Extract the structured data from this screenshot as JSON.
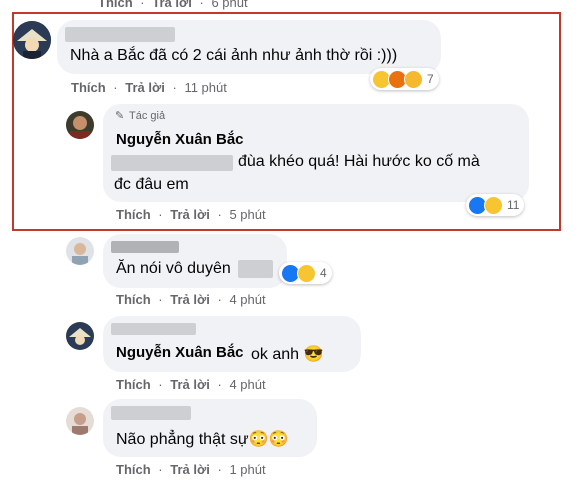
{
  "top_partial": {
    "like": "Thích",
    "reply": "Trả lời",
    "time": "6 phút"
  },
  "comments": [
    {
      "text": "Nhà a Bắc đã có 2 cái ảnh như ảnh thờ rồi :)))",
      "like": "Thích",
      "reply": "Trả lời",
      "time": "11 phút",
      "reaction_count": "7",
      "reactions": [
        "haha-icon",
        "angry-icon",
        "wow-icon"
      ]
    },
    {
      "author_badge": "Tác giả",
      "name": "Nguyễn Xuân Bắc",
      "text_line1": "đùa khéo quá! Hài hước ko cố mà",
      "text_line2": "đc đâu em",
      "like": "Thích",
      "reply": "Trả lời",
      "time": "5 phút",
      "reaction_count": "11",
      "reactions": [
        "like-icon",
        "haha-icon"
      ]
    },
    {
      "text": "Ăn nói vô duyên",
      "like": "Thích",
      "reply": "Trả lời",
      "time": "4 phút",
      "reaction_count": "4",
      "reactions": [
        "like-icon",
        "haha-icon"
      ]
    },
    {
      "name": "Nguyễn Xuân Bắc",
      "text": "ok anh 😎",
      "like": "Thích",
      "reply": "Trả lời",
      "time": "4 phút"
    },
    {
      "text": "Não phẳng thật sự😳😳",
      "like": "Thích",
      "reply": "Trả lời",
      "time": "1 phút"
    }
  ],
  "colors": {
    "highlight": "#c0392b",
    "bubble": "#f0f2f5",
    "meta": "#65676b",
    "like_blue": "#1877f2",
    "haha_yellow": "#f7c531"
  }
}
